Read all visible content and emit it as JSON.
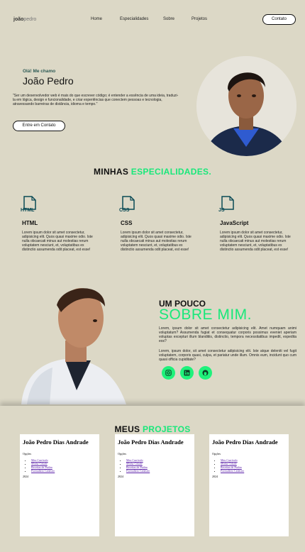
{
  "nav": {
    "logo_bold": "joão",
    "logo_thin": "pedro",
    "links": [
      "Home",
      "Especialidades",
      "Sobre",
      "Projetos"
    ],
    "contact": "Contato"
  },
  "hero": {
    "greeting": "Olá! Me chamo",
    "name": "João Pedro",
    "bio": "\"Ser um desenvolvedor web é mais do que escrever código; é entender a essência de uma ideia, traduzi-la em lógica, design e funcionalidade, e criar experiências que conectem pessoas e tecnologia, atravessando barreiras de distância, idioma e tempo.\"",
    "cta": "Entre em Contato"
  },
  "skills": {
    "title_a": "MINHAS ",
    "title_b": "ESPECIALIDADES.",
    "items": [
      {
        "badge": "HTML",
        "name": "HTML",
        "text": "Lorem ipsum dolor sit amet consectetur, adipisicing elit. Quos quasi maxime odio. Iste nulla obcaecati minus aut molestias rerum voluptatem nesciunt, et, voluptatibus ex distinctio assumenda odit placeat, est esse!"
      },
      {
        "badge": "CSS",
        "name": "CSS",
        "text": "Lorem ipsum dolor sit amet consectetur, adipisicing elit. Quos quasi maxime odio. Iste nulla obcaecati minus aut molestias rerum voluptatem nesciunt, et, voluptatibus ex distinctio assumenda odit placeat, est esse!"
      },
      {
        "badge": "JS",
        "name": "JavaScript",
        "text": "Lorem ipsum dolor sit amet consectetur, adipisicing elit. Quos quasi maxime odio. Iste nulla obcaecati minus aut molestias rerum voluptatem nesciunt, et, voluptatibus ex distinctio assumenda odit placeat, est esse!"
      }
    ]
  },
  "about": {
    "pre": "UM POUCO",
    "big": "SOBRE MIM.",
    "p1": "Lorem, ipsum dolor sit amet consectetur adipisicing elit. Amet numquam animi voluptatum? Assumenda fugiat et consequatur corporis possimus eveniet aperiam voluptas excepturi illum blanditiis, distinctio, tempora necessitatibus impedit, expedita eos?",
    "p2": "Lorem, ipsum dolor, sit amet consectetur adipisicing elit. Iste atque deleniti vel fugit voluptatem, corporis quasi, culpa, et pariatur unde illum. Omnis eum, incidunt quo cum quasi officia cupiditate?",
    "social": [
      "instagram-icon",
      "linkedin-icon",
      "github-icon"
    ]
  },
  "projects": {
    "title_a": "MEUS ",
    "title_b": "PROJETOS",
    "card_title": "João Pedro Dias Andrade",
    "card_label": "Opções",
    "card_links": [
      "Meu Currículo",
      "Minha Cidade",
      "Receitas de Pudim",
      "Formulário Cadastro"
    ],
    "card_footer": "2024"
  },
  "colors": {
    "accent": "#19e87a",
    "background": "#dcd8c6",
    "social": "#1ff27b"
  }
}
